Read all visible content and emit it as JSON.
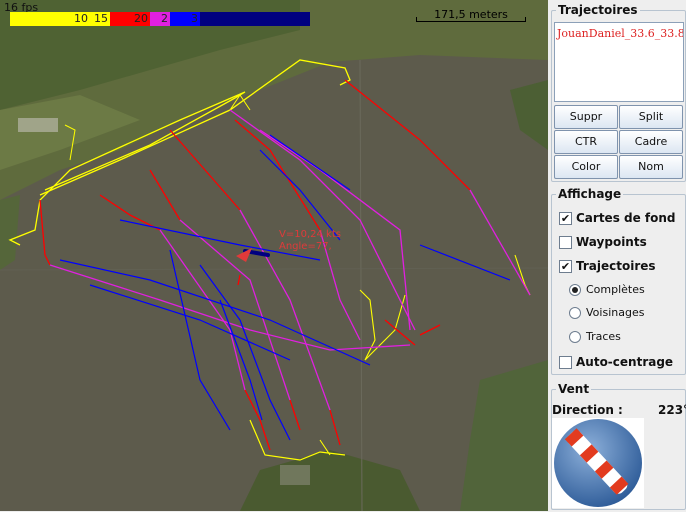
{
  "map": {
    "fps": "16 fps",
    "scale_label": "171,5 meters",
    "speed_legend": [
      {
        "label": "10",
        "color": "#ffff00"
      },
      {
        "label": "15",
        "color": "#ffff00"
      },
      {
        "label": "20",
        "color": "#ff0000"
      },
      {
        "label": "2",
        "color": "#e020e0"
      },
      {
        "label": "3",
        "color": "#0000ff"
      },
      {
        "label": "",
        "color": "#000080"
      }
    ],
    "boat_speed": "V=10,24 kts",
    "boat_angle": "Angle=77,",
    "track_colors": {
      "slow": "#ffff00",
      "medium": "#ff0000",
      "fast": "#e020e0",
      "faster": "#0000ff",
      "fastest": "#000080"
    }
  },
  "panel": {
    "trajectoires": {
      "title": "Trajectoires",
      "items": [
        "JouanDaniel_33.6_33.8"
      ],
      "buttons": [
        "Suppr",
        "Split",
        "CTR",
        "Cadre",
        "Color",
        "Nom"
      ]
    },
    "affichage": {
      "title": "Affichage",
      "checkboxes": [
        {
          "label": "Cartes de fond",
          "checked": true
        },
        {
          "label": "Waypoints",
          "checked": false
        },
        {
          "label": "Trajectoires",
          "checked": true
        }
      ],
      "radios": [
        {
          "label": "Complètes",
          "selected": true
        },
        {
          "label": "Voisinages",
          "selected": false
        },
        {
          "label": "Traces",
          "selected": false
        }
      ],
      "auto_center": {
        "label": "Auto-centrage",
        "checked": false
      }
    },
    "vent": {
      "title": "Vent",
      "direction_label": "Direction :",
      "direction_value": "223°"
    }
  }
}
